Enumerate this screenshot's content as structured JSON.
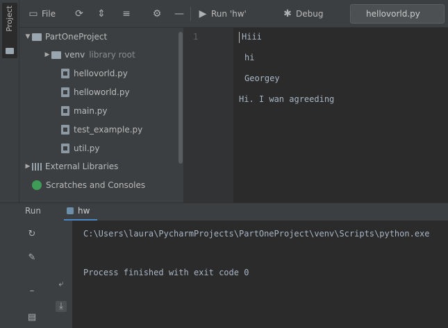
{
  "left_strip": {
    "project_tab": "Project"
  },
  "toolbar": {
    "buttons": [
      {
        "icon": "file-icon",
        "label": "File"
      },
      {
        "icon": "refresh-icon",
        "label": ""
      },
      {
        "icon": "collapse-icon",
        "label": ""
      },
      {
        "icon": "sort-icon",
        "label": ""
      },
      {
        "icon": "gear-icon",
        "label": ""
      },
      {
        "icon": "minus-icon",
        "label": ""
      }
    ],
    "run_label": "Run 'hw'",
    "debug_label": "Debug",
    "config": "hellovorld.py"
  },
  "tree": {
    "root": "PartOneProject",
    "venv": "venv",
    "venv_hint": "library root",
    "files": [
      "hellovorld.py",
      "helloworld.py",
      "main.py",
      "test_example.py",
      "util.py"
    ],
    "external": "External Libraries",
    "scratches": "Scratches and Consoles"
  },
  "editor": {
    "line_number": "1",
    "lines": [
      "Hiii",
      "hi",
      "Georgey",
      "Hi. I wan agreeding"
    ]
  },
  "run": {
    "tabs": [
      "Run",
      "hw"
    ],
    "console_lines": [
      {
        "text": "C:\\Users\\laura\\PycharmProjects\\PartOneProject\\venv\\Scripts\\python.exe",
        "color": "#a9b7c6"
      },
      {
        "text": "",
        "color": "#a9b7c6"
      },
      {
        "text": "Process finished with exit code 0",
        "color": "#a9b7c6"
      }
    ]
  },
  "colors": {
    "accent": "#4a88c7",
    "panel": "#3c3f41",
    "editor_bg": "#2b2b2b"
  }
}
